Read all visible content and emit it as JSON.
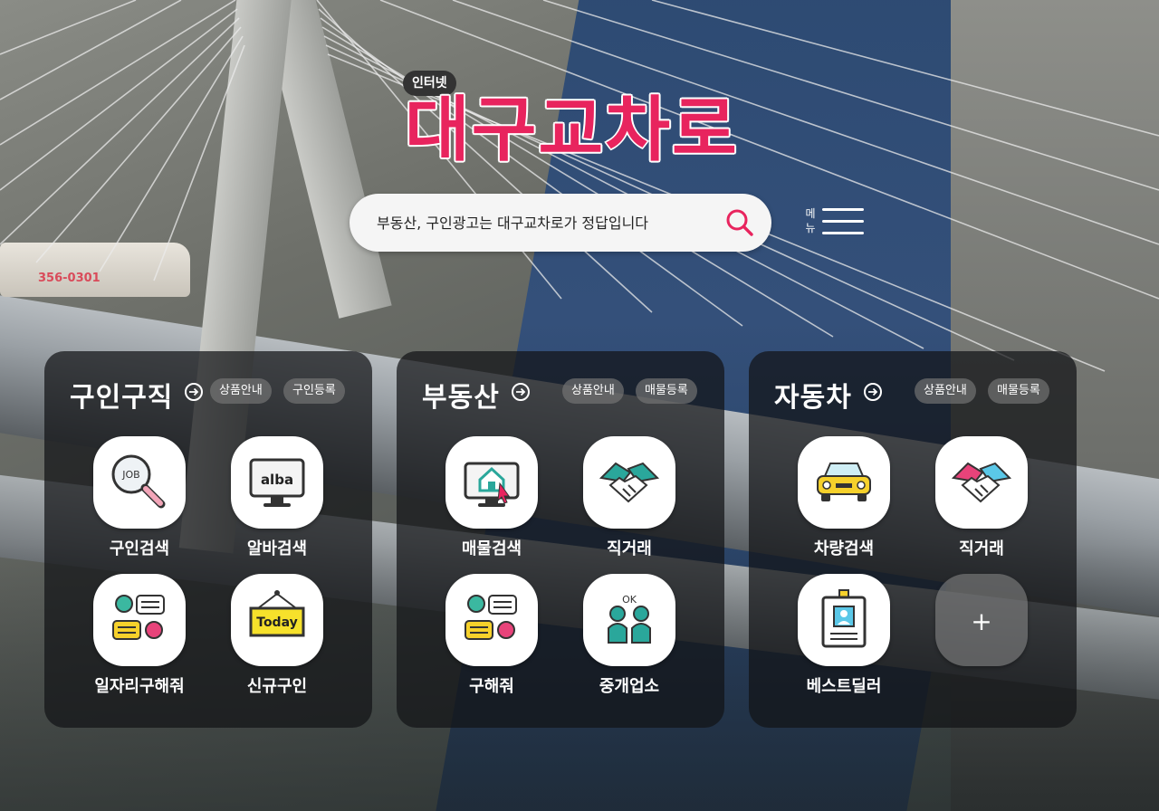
{
  "header": {
    "badge": "인터넷",
    "logo": "대구교차로",
    "search_placeholder": "부동산, 구인광고는 대구교차로가 정답입니다",
    "menu_label_1": "메",
    "menu_label_2": "뉴"
  },
  "background": {
    "train_number": "356-0301"
  },
  "colors": {
    "brand": "#e8245e",
    "panel": "#141618",
    "pill": "#787878"
  },
  "panels": {
    "jobs": {
      "title": "구인구직",
      "pills": [
        "상품안내",
        "구인등록"
      ],
      "tiles": [
        {
          "label": "구인검색",
          "icon": "job-search-icon"
        },
        {
          "label": "알바검색",
          "icon": "alba-monitor-icon",
          "icon_text": "alba"
        },
        {
          "label": "일자리구해줘",
          "icon": "chat-people-icon"
        },
        {
          "label": "신규구인",
          "icon": "today-sign-icon",
          "icon_text": "Today"
        }
      ]
    },
    "estate": {
      "title": "부동산",
      "pills": [
        "상품안내",
        "매물등록"
      ],
      "tiles": [
        {
          "label": "매물검색",
          "icon": "house-monitor-icon"
        },
        {
          "label": "직거래",
          "icon": "handshake-icon"
        },
        {
          "label": "구해줘",
          "icon": "chat-people-icon"
        },
        {
          "label": "중개업소",
          "icon": "ok-people-icon",
          "icon_text": "OK"
        }
      ]
    },
    "car": {
      "title": "자동차",
      "pills": [
        "상품안내",
        "매물등록"
      ],
      "tiles": [
        {
          "label": "차량검색",
          "icon": "car-icon"
        },
        {
          "label": "직거래",
          "icon": "handshake-icon"
        },
        {
          "label": "베스트딜러",
          "icon": "id-card-icon"
        },
        {
          "label": "",
          "icon": "plus-icon",
          "icon_text": "+"
        }
      ]
    }
  }
}
